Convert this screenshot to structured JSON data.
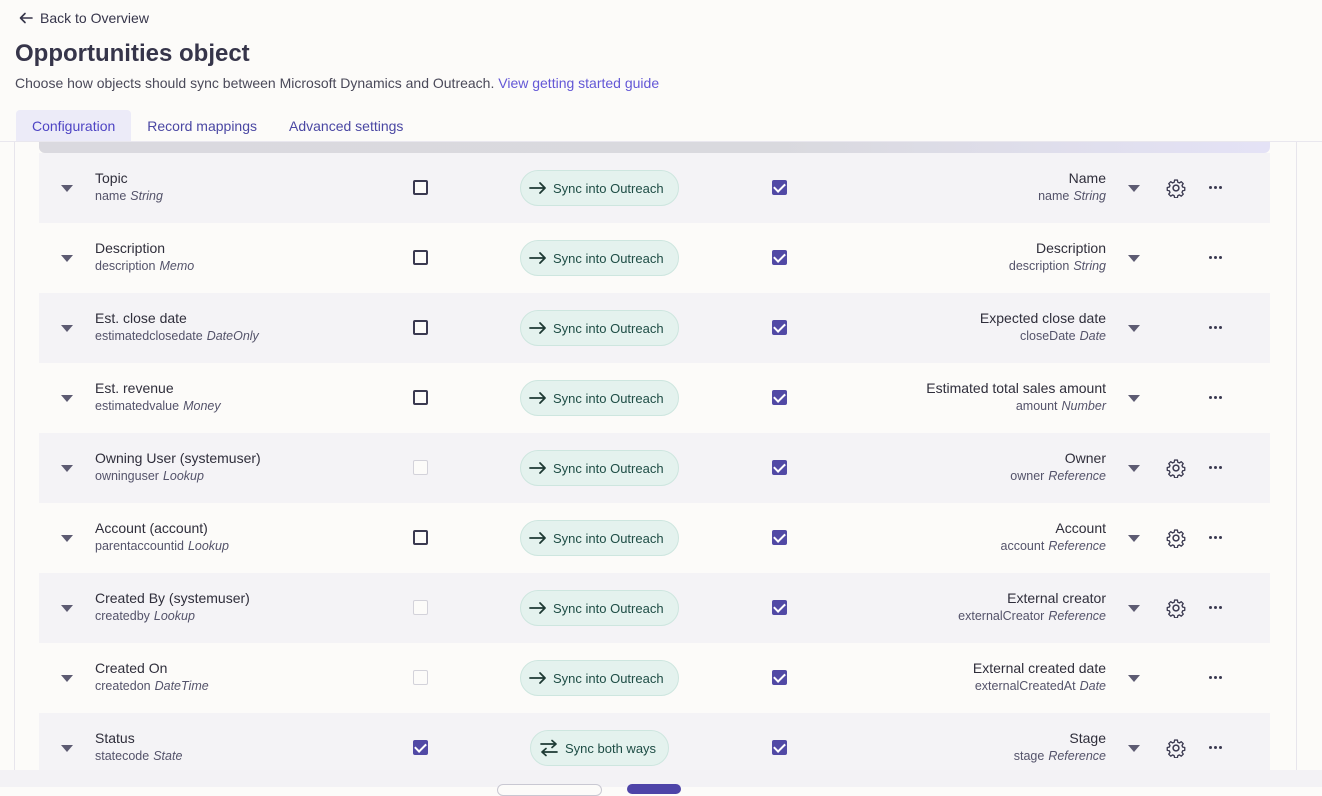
{
  "header": {
    "back_label": "Back to Overview",
    "title": "Opportunities object",
    "subtitle": "Choose how objects should sync between Microsoft Dynamics and Outreach.",
    "guide_link": "View getting started guide"
  },
  "tabs": [
    {
      "label": "Configuration",
      "active": true
    },
    {
      "label": "Record mappings",
      "active": false
    },
    {
      "label": "Advanced settings",
      "active": false
    }
  ],
  "colors": {
    "accent": "#5149a5",
    "sync_bg": "#e4f2ee",
    "link": "#6357d6"
  },
  "rows": [
    {
      "src_label": "Topic",
      "src_field": "name",
      "src_type": "String",
      "left_check": "unchecked",
      "direction": "Sync into Outreach",
      "right_check": "checked",
      "dst_label": "Name",
      "dst_field": "name",
      "dst_type": "String",
      "settings": true
    },
    {
      "src_label": "Description",
      "src_field": "description",
      "src_type": "Memo",
      "left_check": "unchecked",
      "direction": "Sync into Outreach",
      "right_check": "checked",
      "dst_label": "Description",
      "dst_field": "description",
      "dst_type": "String",
      "settings": false
    },
    {
      "src_label": "Est. close date",
      "src_field": "estimatedclosedate",
      "src_type": "DateOnly",
      "left_check": "unchecked",
      "direction": "Sync into Outreach",
      "right_check": "checked",
      "dst_label": "Expected close date",
      "dst_field": "closeDate",
      "dst_type": "Date",
      "settings": false
    },
    {
      "src_label": "Est. revenue",
      "src_field": "estimatedvalue",
      "src_type": "Money",
      "left_check": "unchecked",
      "direction": "Sync into Outreach",
      "right_check": "checked",
      "dst_label": "Estimated total sales amount",
      "dst_field": "amount",
      "dst_type": "Number",
      "settings": false
    },
    {
      "src_label": "Owning User (systemuser)",
      "src_field": "owninguser",
      "src_type": "Lookup",
      "left_check": "disabled",
      "direction": "Sync into Outreach",
      "right_check": "checked",
      "dst_label": "Owner",
      "dst_field": "owner",
      "dst_type": "Reference",
      "settings": true
    },
    {
      "src_label": "Account (account)",
      "src_field": "parentaccountid",
      "src_type": "Lookup",
      "left_check": "unchecked",
      "direction": "Sync into Outreach",
      "right_check": "checked",
      "dst_label": "Account",
      "dst_field": "account",
      "dst_type": "Reference",
      "settings": true
    },
    {
      "src_label": "Created By (systemuser)",
      "src_field": "createdby",
      "src_type": "Lookup",
      "left_check": "disabled",
      "direction": "Sync into Outreach",
      "right_check": "checked",
      "dst_label": "External creator",
      "dst_field": "externalCreator",
      "dst_type": "Reference",
      "settings": true
    },
    {
      "src_label": "Created On",
      "src_field": "createdon",
      "src_type": "DateTime",
      "left_check": "disabled",
      "direction": "Sync into Outreach",
      "right_check": "checked",
      "dst_label": "External created date",
      "dst_field": "externalCreatedAt",
      "dst_type": "Date",
      "settings": false
    },
    {
      "src_label": "Status",
      "src_field": "statecode",
      "src_type": "State",
      "left_check": "checked",
      "direction": "Sync both ways",
      "right_check": "checked",
      "dst_label": "Stage",
      "dst_field": "stage",
      "dst_type": "Reference",
      "settings": true
    }
  ]
}
